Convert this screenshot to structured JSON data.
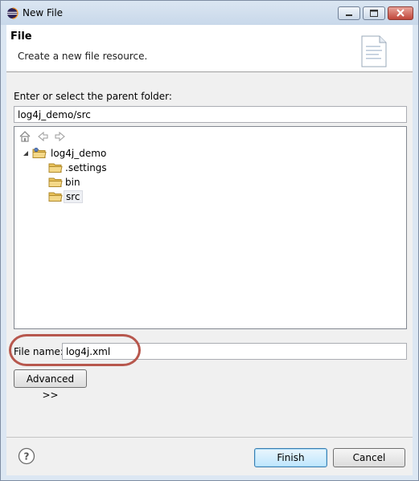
{
  "window": {
    "title": "New File",
    "controls": [
      "minimize",
      "maximize",
      "close"
    ]
  },
  "header": {
    "title": "File",
    "description": "Create a new file resource.",
    "image": "new-file-wizard-icon"
  },
  "parent_folder": {
    "label": "Enter or select the parent folder:",
    "value": "log4j_demo/src"
  },
  "tree": {
    "toolbar": [
      "home-icon",
      "back-arrow-icon",
      "forward-arrow-icon"
    ],
    "items": [
      {
        "label": "log4j_demo",
        "icon": "project-folder-icon",
        "expanded": true
      },
      {
        "label": ".settings",
        "icon": "folder-icon"
      },
      {
        "label": "bin",
        "icon": "folder-icon"
      },
      {
        "label": "src",
        "icon": "folder-icon",
        "selected": true
      }
    ]
  },
  "file_name": {
    "label": "File name:",
    "value": "log4j.xml"
  },
  "buttons": {
    "advanced": "Advanced >>",
    "finish": "Finish",
    "cancel": "Cancel"
  },
  "colors": {
    "highlight_ring": "#b7574d",
    "dialog_background": "#f0f0f0",
    "folder": "#e8c15a"
  }
}
